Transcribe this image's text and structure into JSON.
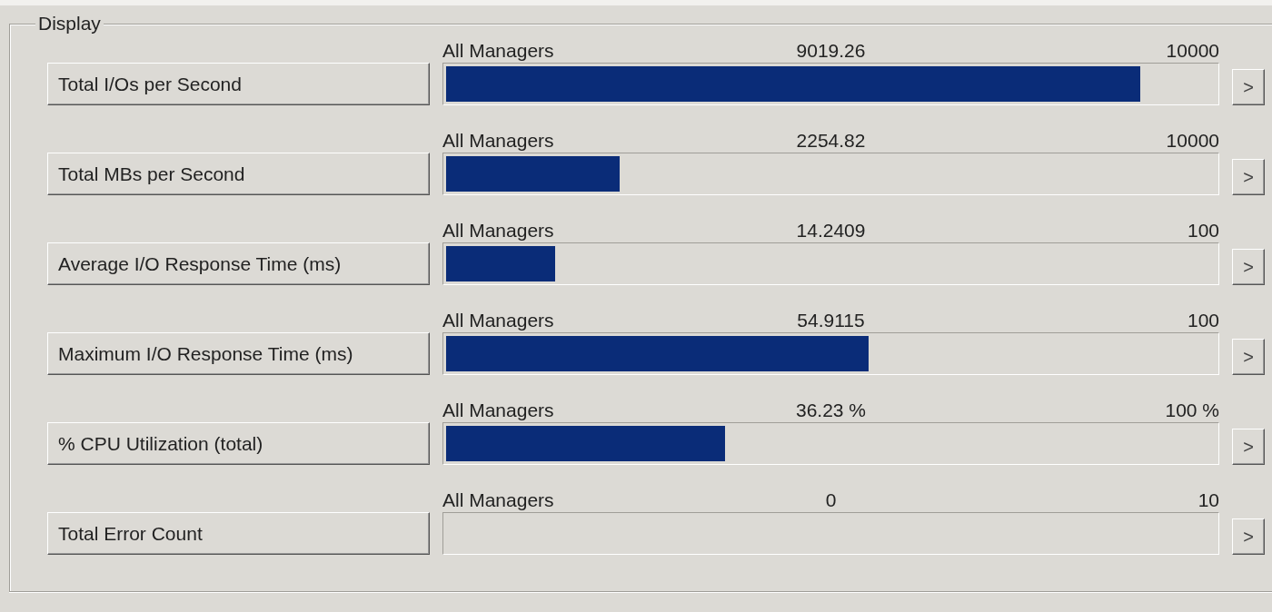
{
  "group": {
    "title": "Display"
  },
  "meters": [
    {
      "button": "Total I/Os per Second",
      "scope": "All Managers",
      "reading": "9019.26",
      "max": "10000",
      "level": 0.902,
      "arrow": ">"
    },
    {
      "button": "Total MBs per Second",
      "scope": "All Managers",
      "reading": "2254.82",
      "max": "10000",
      "level": 0.225,
      "arrow": ">"
    },
    {
      "button": "Average I/O Response Time (ms)",
      "scope": "All Managers",
      "reading": "14.2409",
      "max": "100",
      "level": 0.142,
      "arrow": ">"
    },
    {
      "button": "Maximum I/O Response Time (ms)",
      "scope": "All Managers",
      "reading": "54.9115",
      "max": "100",
      "level": 0.549,
      "arrow": ">"
    },
    {
      "button": "% CPU Utilization (total)",
      "scope": "All Managers",
      "reading": "36.23 %",
      "max": "100 %",
      "level": 0.362,
      "arrow": ">"
    },
    {
      "button": "Total Error Count",
      "scope": "All Managers",
      "reading": "0",
      "max": "10",
      "arrow": ">"
    }
  ]
}
